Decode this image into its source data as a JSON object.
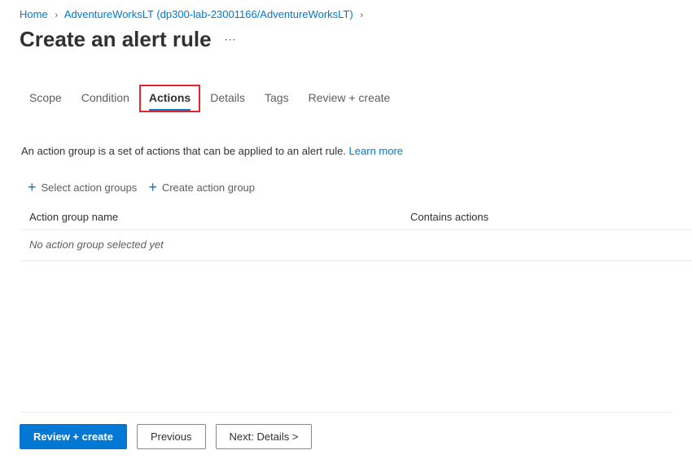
{
  "breadcrumb": {
    "home": "Home",
    "resource": "AdventureWorksLT (dp300-lab-23001166/AdventureWorksLT)"
  },
  "header": {
    "title": "Create an alert rule"
  },
  "tabs": {
    "scope": "Scope",
    "condition": "Condition",
    "actions": "Actions",
    "details": "Details",
    "tags": "Tags",
    "review": "Review + create"
  },
  "content": {
    "description": "An action group is a set of actions that can be applied to an alert rule.",
    "learn_more": "Learn more",
    "select_action_groups": "Select action groups",
    "create_action_group": "Create action group",
    "col_name": "Action group name",
    "col_actions": "Contains actions",
    "empty_row": "No action group selected yet"
  },
  "footer": {
    "review": "Review + create",
    "previous": "Previous",
    "next": "Next: Details >"
  }
}
